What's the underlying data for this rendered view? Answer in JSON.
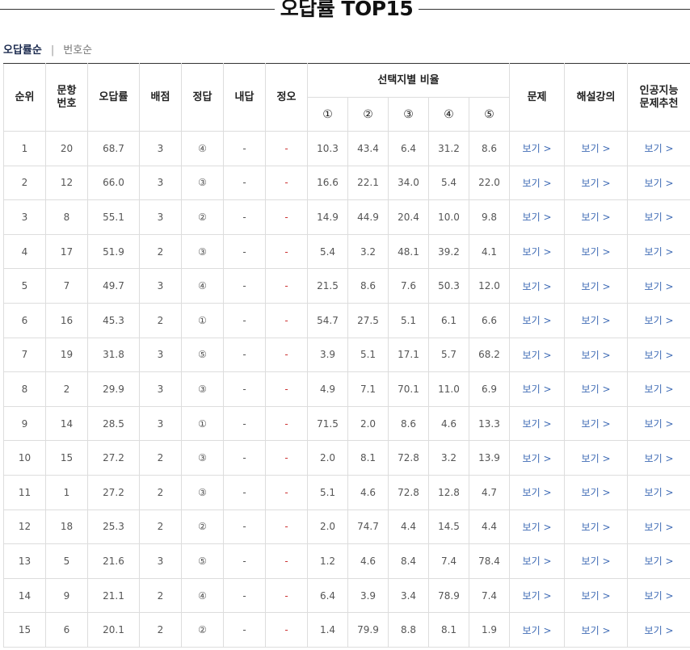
{
  "title": "오답률 TOP15",
  "sort_tabs": {
    "active": "오답률순",
    "inactive": "번호순",
    "separator": "|"
  },
  "headers": {
    "rank": "순위",
    "question_no_line1": "문항",
    "question_no_line2": "번호",
    "error_rate": "오답률",
    "points": "배점",
    "answer": "정답",
    "my_answer": "내답",
    "correct_wrong": "정오",
    "choice_ratio": "선택지별 비율",
    "choices": [
      "①",
      "②",
      "③",
      "④",
      "⑤"
    ],
    "problem": "문제",
    "lecture": "해설강의",
    "ai_line1": "인공지능",
    "ai_line2": "문제추천"
  },
  "link_label": "보기 >",
  "rows": [
    {
      "rank": "1",
      "no": "20",
      "rate": "68.7",
      "points": "3",
      "answer": "④",
      "mine": "-",
      "ox": "-",
      "r": [
        "10.3",
        "43.4",
        "6.4",
        "31.2",
        "8.6"
      ]
    },
    {
      "rank": "2",
      "no": "12",
      "rate": "66.0",
      "points": "3",
      "answer": "③",
      "mine": "-",
      "ox": "-",
      "r": [
        "16.6",
        "22.1",
        "34.0",
        "5.4",
        "22.0"
      ]
    },
    {
      "rank": "3",
      "no": "8",
      "rate": "55.1",
      "points": "3",
      "answer": "②",
      "mine": "-",
      "ox": "-",
      "r": [
        "14.9",
        "44.9",
        "20.4",
        "10.0",
        "9.8"
      ]
    },
    {
      "rank": "4",
      "no": "17",
      "rate": "51.9",
      "points": "2",
      "answer": "③",
      "mine": "-",
      "ox": "-",
      "r": [
        "5.4",
        "3.2",
        "48.1",
        "39.2",
        "4.1"
      ]
    },
    {
      "rank": "5",
      "no": "7",
      "rate": "49.7",
      "points": "3",
      "answer": "④",
      "mine": "-",
      "ox": "-",
      "r": [
        "21.5",
        "8.6",
        "7.6",
        "50.3",
        "12.0"
      ]
    },
    {
      "rank": "6",
      "no": "16",
      "rate": "45.3",
      "points": "2",
      "answer": "①",
      "mine": "-",
      "ox": "-",
      "r": [
        "54.7",
        "27.5",
        "5.1",
        "6.1",
        "6.6"
      ]
    },
    {
      "rank": "7",
      "no": "19",
      "rate": "31.8",
      "points": "3",
      "answer": "⑤",
      "mine": "-",
      "ox": "-",
      "r": [
        "3.9",
        "5.1",
        "17.1",
        "5.7",
        "68.2"
      ]
    },
    {
      "rank": "8",
      "no": "2",
      "rate": "29.9",
      "points": "3",
      "answer": "③",
      "mine": "-",
      "ox": "-",
      "r": [
        "4.9",
        "7.1",
        "70.1",
        "11.0",
        "6.9"
      ]
    },
    {
      "rank": "9",
      "no": "14",
      "rate": "28.5",
      "points": "3",
      "answer": "①",
      "mine": "-",
      "ox": "-",
      "r": [
        "71.5",
        "2.0",
        "8.6",
        "4.6",
        "13.3"
      ]
    },
    {
      "rank": "10",
      "no": "15",
      "rate": "27.2",
      "points": "2",
      "answer": "③",
      "mine": "-",
      "ox": "-",
      "r": [
        "2.0",
        "8.1",
        "72.8",
        "3.2",
        "13.9"
      ]
    },
    {
      "rank": "11",
      "no": "1",
      "rate": "27.2",
      "points": "2",
      "answer": "③",
      "mine": "-",
      "ox": "-",
      "r": [
        "5.1",
        "4.6",
        "72.8",
        "12.8",
        "4.7"
      ]
    },
    {
      "rank": "12",
      "no": "18",
      "rate": "25.3",
      "points": "2",
      "answer": "②",
      "mine": "-",
      "ox": "-",
      "r": [
        "2.0",
        "74.7",
        "4.4",
        "14.5",
        "4.4"
      ]
    },
    {
      "rank": "13",
      "no": "5",
      "rate": "21.6",
      "points": "3",
      "answer": "⑤",
      "mine": "-",
      "ox": "-",
      "r": [
        "1.2",
        "4.6",
        "8.4",
        "7.4",
        "78.4"
      ]
    },
    {
      "rank": "14",
      "no": "9",
      "rate": "21.1",
      "points": "2",
      "answer": "④",
      "mine": "-",
      "ox": "-",
      "r": [
        "6.4",
        "3.9",
        "3.4",
        "78.9",
        "7.4"
      ]
    },
    {
      "rank": "15",
      "no": "6",
      "rate": "20.1",
      "points": "2",
      "answer": "②",
      "mine": "-",
      "ox": "-",
      "r": [
        "1.4",
        "79.9",
        "8.8",
        "8.1",
        "1.9"
      ]
    }
  ]
}
